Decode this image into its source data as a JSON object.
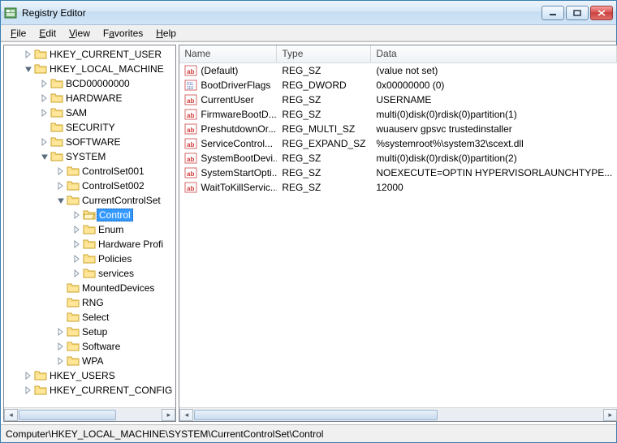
{
  "window": {
    "title": "Registry Editor"
  },
  "menu": {
    "file": "File",
    "edit": "Edit",
    "view": "View",
    "favorites": "Favorites",
    "help": "Help"
  },
  "tree": {
    "hkcu": "HKEY_CURRENT_USER",
    "hklm": "HKEY_LOCAL_MACHINE",
    "bcd": "BCD00000000",
    "hardware": "HARDWARE",
    "sam": "SAM",
    "security": "SECURITY",
    "software": "SOFTWARE",
    "system": "SYSTEM",
    "cs1": "ControlSet001",
    "cs2": "ControlSet002",
    "ccs": "CurrentControlSet",
    "control": "Control",
    "enum": "Enum",
    "hwprof": "Hardware Profi",
    "policies": "Policies",
    "services": "services",
    "mounted": "MountedDevices",
    "rng": "RNG",
    "select": "Select",
    "setup": "Setup",
    "software2": "Software",
    "wpa": "WPA",
    "hku": "HKEY_USERS",
    "hkcc": "HKEY_CURRENT_CONFIG"
  },
  "columns": {
    "name": "Name",
    "type": "Type",
    "data": "Data"
  },
  "values": [
    {
      "icon": "sz",
      "name": "(Default)",
      "type": "REG_SZ",
      "data": "(value not set)"
    },
    {
      "icon": "bin",
      "name": "BootDriverFlags",
      "type": "REG_DWORD",
      "data": "0x00000000 (0)"
    },
    {
      "icon": "sz",
      "name": "CurrentUser",
      "type": "REG_SZ",
      "data": "USERNAME"
    },
    {
      "icon": "sz",
      "name": "FirmwareBootD...",
      "type": "REG_SZ",
      "data": "multi(0)disk(0)rdisk(0)partition(1)"
    },
    {
      "icon": "sz",
      "name": "PreshutdownOr...",
      "type": "REG_MULTI_SZ",
      "data": "wuauserv gpsvc trustedinstaller"
    },
    {
      "icon": "sz",
      "name": "ServiceControl...",
      "type": "REG_EXPAND_SZ",
      "data": "%systemroot%\\system32\\scext.dll"
    },
    {
      "icon": "sz",
      "name": "SystemBootDevi...",
      "type": "REG_SZ",
      "data": "multi(0)disk(0)rdisk(0)partition(2)"
    },
    {
      "icon": "sz",
      "name": "SystemStartOpti...",
      "type": "REG_SZ",
      "data": " NOEXECUTE=OPTIN  HYPERVISORLAUNCHTYPE..."
    },
    {
      "icon": "sz",
      "name": "WaitToKillServic...",
      "type": "REG_SZ",
      "data": "12000"
    }
  ],
  "statusbar": {
    "path": "Computer\\HKEY_LOCAL_MACHINE\\SYSTEM\\CurrentControlSet\\Control"
  }
}
